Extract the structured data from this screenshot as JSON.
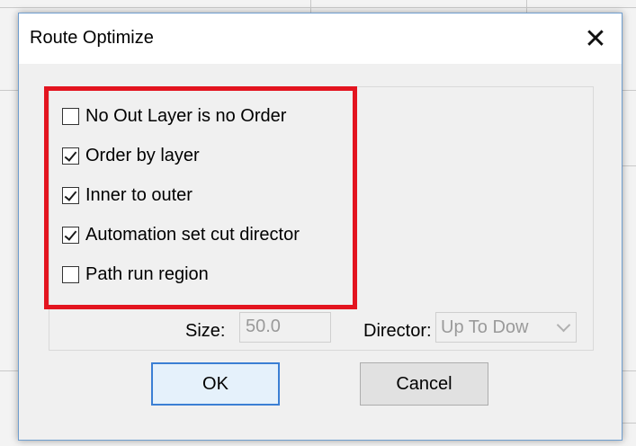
{
  "dialog": {
    "title": "Route Optimize",
    "close_symbol": "✕"
  },
  "options": [
    {
      "label": "No Out Layer is no Order",
      "checked": false
    },
    {
      "label": "Order by layer",
      "checked": true
    },
    {
      "label": "Inner to outer",
      "checked": true
    },
    {
      "label": "Automation set cut director",
      "checked": true
    },
    {
      "label": "Path run region",
      "checked": false
    }
  ],
  "size": {
    "label": "Size:",
    "value": "50.0"
  },
  "director": {
    "label": "Director:",
    "value": "Up To Dow"
  },
  "buttons": {
    "ok": "OK",
    "cancel": "Cancel"
  },
  "colors": {
    "highlight": "#e3141f",
    "ok_border": "#3b7fd4"
  }
}
